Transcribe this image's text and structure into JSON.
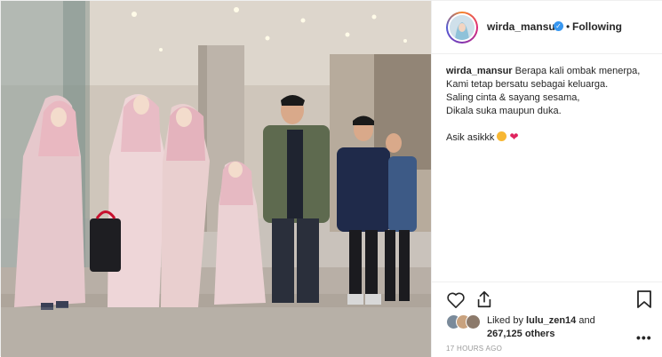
{
  "post": {
    "photo_alt": "",
    "author": {
      "username": "wirda_mansur",
      "verified": true,
      "follow_status": "Following",
      "separator": "•"
    },
    "caption": {
      "username": "wirda_mansur",
      "lines": [
        "Berapa kali ombak menerpa,",
        "Kami tetap bersatu sebagai keluarga.",
        "Saling cinta & sayang sesama,",
        "Dikala suka maupun duka."
      ],
      "closing": "Asik asikkk"
    },
    "likes": {
      "prefix": "Liked by",
      "liker": "lulu_zen14",
      "and": "and",
      "count": "267,125 others"
    },
    "timestamp": "17 HOURS AGO",
    "more_label": "•••"
  },
  "icons": {
    "like": "heart-outline-icon",
    "share": "share-icon",
    "save": "bookmark-icon",
    "verified": "verified-badge-icon"
  },
  "colors": {
    "verified_blue": "#3897f0",
    "text": "#262626",
    "muted": "#999999",
    "border": "#efefef"
  }
}
